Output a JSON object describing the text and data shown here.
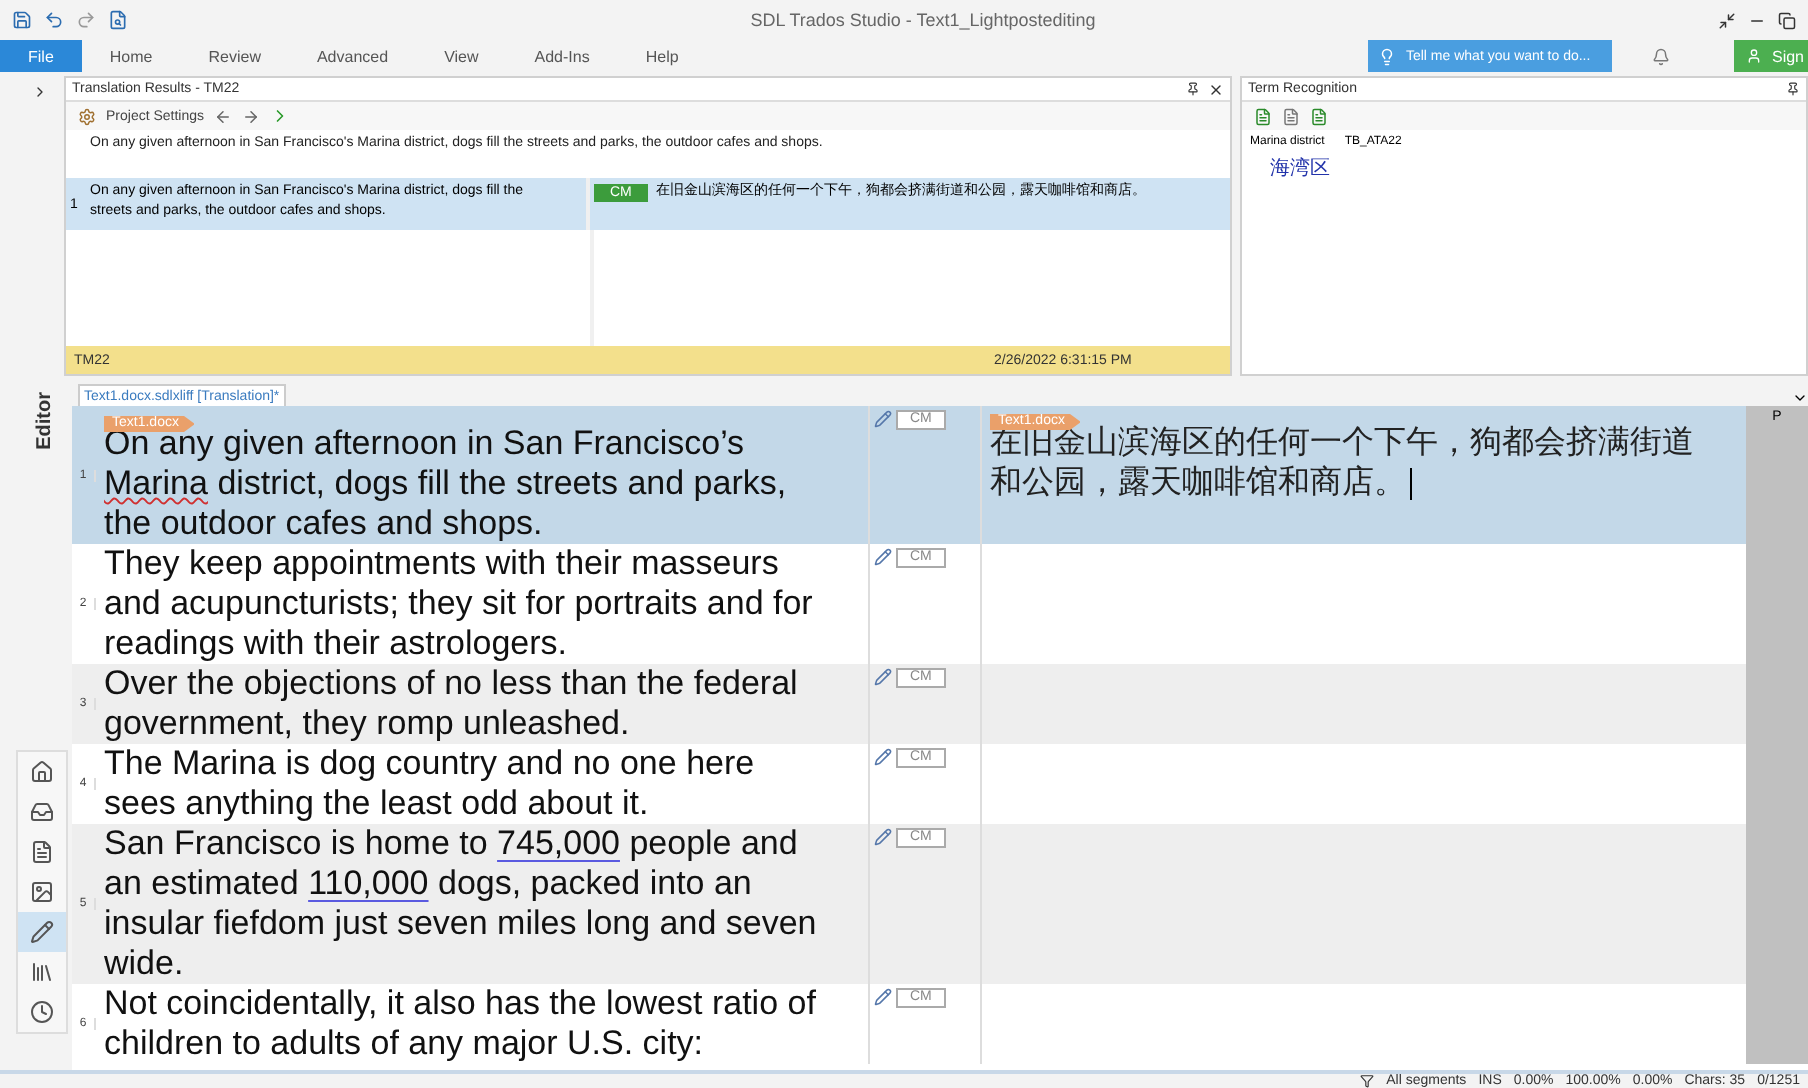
{
  "window": {
    "title": "SDL Trados Studio - Text1_Lightpostediting"
  },
  "ribbon": {
    "tabs": [
      {
        "label": "File",
        "selected": true
      },
      {
        "label": "Home",
        "selected": false
      },
      {
        "label": "Review",
        "selected": false
      },
      {
        "label": "Advanced",
        "selected": false
      },
      {
        "label": "View",
        "selected": false
      },
      {
        "label": "Add-Ins",
        "selected": false
      },
      {
        "label": "Help",
        "selected": false
      }
    ],
    "tell_me": {
      "placeholder": "Tell me what you want to do..."
    },
    "sign_in": "Sign"
  },
  "translation_results": {
    "title": "Translation Results - TM22",
    "toolbar_label": "Project Settings",
    "source": "On any given afternoon in San Francisco's Marina district, dogs fill the streets and parks, the outdoor cafes and shops.",
    "matches": [
      {
        "number": "1",
        "source": "On any given afternoon in San Francisco's Marina district, dogs fill the streets and parks, the outdoor cafes and shops.",
        "badge": "CM",
        "target": "在旧金山滨海区的任何一个下午，狗都会挤满街道和公园，露天咖啡馆和商店。",
        "selected": true
      }
    ],
    "footer": {
      "tm": "TM22",
      "date": "2/26/2022 6:31:15 PM"
    }
  },
  "term_recognition": {
    "title": "Term Recognition",
    "terms": [
      {
        "source": "Marina district",
        "termbase": "TB_ATA22",
        "target": "海湾区"
      }
    ]
  },
  "editor": {
    "side_label": "Editor",
    "nav_items": [
      {
        "kind": "home",
        "selected": false
      },
      {
        "kind": "inbox",
        "selected": false
      },
      {
        "kind": "file",
        "selected": false
      },
      {
        "kind": "image",
        "selected": false
      },
      {
        "kind": "pencil",
        "selected": true
      },
      {
        "kind": "books",
        "selected": false
      },
      {
        "kind": "clock",
        "selected": false
      }
    ],
    "document_tab": "Text1.docx.sdlxliff [Translation]*",
    "segments": [
      {
        "number": "1",
        "selected": true,
        "tag": "Text1.docx",
        "source": [
          {
            "text": "On any given afternoon in San Francisco’s "
          },
          {
            "text": "Marina",
            "misspelled": true
          },
          {
            "text": " district, dogs fill the streets and parks, the outdoor cafes and shops."
          }
        ],
        "status": "CM",
        "target_tag": "Text1.docx",
        "target": "在旧金山滨海区的任何一个下午，狗都会挤满街道和公园，露天咖啡馆和商店。",
        "column_5": "P"
      },
      {
        "number": "2",
        "selected": false,
        "source": [
          {
            "text": "They keep appointments with their masseurs and acupuncturists; they sit for portraits and for readings with their astrologers."
          }
        ],
        "status": "CM"
      },
      {
        "number": "3",
        "selected": false,
        "source": [
          {
            "text": "Over the objections of no less than the federal government, they romp unleashed."
          }
        ],
        "status": "CM"
      },
      {
        "number": "4",
        "selected": false,
        "source": [
          {
            "text": "The Marina is dog country and no one here sees anything the least odd about it."
          }
        ],
        "status": "CM"
      },
      {
        "number": "5",
        "selected": false,
        "source": [
          {
            "text": "San Francisco is home to "
          },
          {
            "text": "745,000",
            "recognized": true
          },
          {
            "text": " people and an estimated "
          },
          {
            "text": "110,000",
            "recognized": true
          },
          {
            "text": " dogs, packed into an insular fiefdom just seven miles long and seven wide."
          }
        ],
        "status": "CM"
      },
      {
        "number": "6",
        "selected": false,
        "source": [
          {
            "text": "Not coincidentally, it also has the lowest ratio of children to adults of any major U.S. city:"
          }
        ],
        "status": "CM"
      }
    ]
  },
  "status_bar": [
    "All segments",
    "INS",
    "0.00%",
    "100.00%",
    "0.00%",
    "Chars: 35",
    "0/1251"
  ]
}
